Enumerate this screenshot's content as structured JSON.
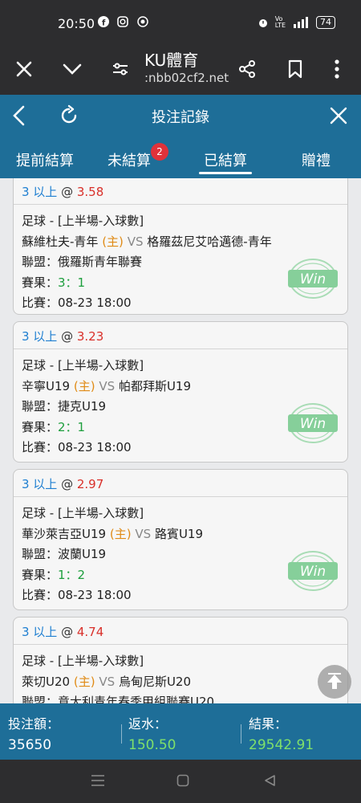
{
  "status": {
    "time": "20:50",
    "battery": "74"
  },
  "browser": {
    "site_name": "KU體育",
    "url": ":nbb02cf2.net"
  },
  "header": {
    "title": "投注記錄"
  },
  "tabs": [
    {
      "label": "提前結算"
    },
    {
      "label": "未結算",
      "badge": "2"
    },
    {
      "label": "已結算",
      "active": true
    },
    {
      "label": "贈禮"
    }
  ],
  "bets": [
    {
      "bet": "3 以上",
      "at": "@",
      "odds": "3.58",
      "category": "足球 - [上半場-入球數]",
      "home": "蘇維杜夫-青年",
      "host_tag": "(主)",
      "vs": "VS",
      "away": "格羅茲尼艾哈邁德-青年",
      "league_label": "聯盟：",
      "league": "俄羅斯青年聯賽",
      "result_label": "賽果：",
      "result": "3：1",
      "time_label": "比賽：",
      "time": "08-23 18:00",
      "stamp": "Win"
    },
    {
      "bet": "3 以上",
      "at": "@",
      "odds": "3.23",
      "category": "足球 - [上半場-入球數]",
      "home": "辛寧U19",
      "host_tag": "(主)",
      "vs": "VS",
      "away": "帕都拜斯U19",
      "league_label": "聯盟：",
      "league": "捷克U19",
      "result_label": "賽果：",
      "result": "2：1",
      "time_label": "比賽：",
      "time": "08-23 18:00",
      "stamp": "Win"
    },
    {
      "bet": "3 以上",
      "at": "@",
      "odds": "2.97",
      "category": "足球 - [上半場-入球數]",
      "home": "華沙萊吉亞U19",
      "host_tag": "(主)",
      "vs": "VS",
      "away": "路賓U19",
      "league_label": "聯盟：",
      "league": "波蘭U19",
      "result_label": "賽果：",
      "result": "1：2",
      "time_label": "比賽：",
      "time": "08-23 18:00",
      "stamp": "Win"
    },
    {
      "bet": "3 以上",
      "at": "@",
      "odds": "4.74",
      "category": "足球 - [上半場-入球數]",
      "home": "萊切U20",
      "host_tag": "(主)",
      "vs": "VS",
      "away": "烏甸尼斯U20",
      "league_label": "聯盟：",
      "league": "意大利青年春季甲組聯賽U20"
    }
  ],
  "summary": [
    {
      "label": "投注額：",
      "value": "35650"
    },
    {
      "label": "返水：",
      "value": "150.50"
    },
    {
      "label": "結果：",
      "value": "29542.91"
    }
  ],
  "colors": {
    "header_blue": "#1e6e98",
    "odds_red": "#d9302a",
    "bet_blue": "#1f7fd1",
    "host_orange": "#e08b16",
    "score_green": "#1c9e3c",
    "win_green": "#7fcf95"
  }
}
